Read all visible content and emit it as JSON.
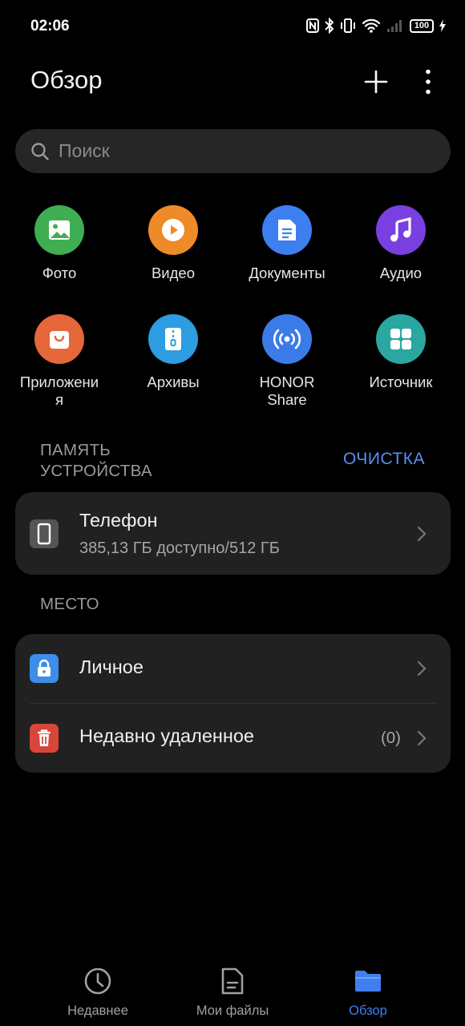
{
  "status_bar": {
    "time": "02:06",
    "battery": "100"
  },
  "header": {
    "title": "Обзор",
    "add_icon": "plus-icon",
    "menu_icon": "more-vertical-icon"
  },
  "search": {
    "placeholder": "Поиск"
  },
  "categories": [
    {
      "label": "Фото",
      "icon": "photo-icon",
      "color": "#3fae52"
    },
    {
      "label": "Видео",
      "icon": "video-play-icon",
      "color": "#ee8a27"
    },
    {
      "label": "Документы",
      "icon": "document-icon",
      "color": "#3d7ff0"
    },
    {
      "label": "Аудио",
      "icon": "music-note-icon",
      "color": "#7a3fe0"
    },
    {
      "label": "Приложени\nя",
      "icon": "shopping-bag-icon",
      "color": "#e5673a"
    },
    {
      "label": "Архивы",
      "icon": "zip-archive-icon",
      "color": "#2d9ce0"
    },
    {
      "label": "HONOR\nShare",
      "icon": "honor-share-icon",
      "color": "#3b7be8"
    },
    {
      "label": "Источник",
      "icon": "grid-source-icon",
      "color": "#2aa7a0"
    }
  ],
  "storage": {
    "section_label": "ПАМЯТЬ\nУСТРОЙСТВА",
    "clean_label": "ОЧИСТКА",
    "phone": {
      "title": "Телефон",
      "subtitle": "385,13 ГБ доступно/512 ГБ"
    }
  },
  "places": {
    "section_label": "МЕСТО",
    "items": [
      {
        "title": "Личное",
        "icon": "lock-icon",
        "color": "#3c8ee8"
      },
      {
        "title": "Недавно удаленное",
        "icon": "trash-icon",
        "color": "#d8453a",
        "count": "(0)"
      }
    ]
  },
  "bottom_nav": {
    "items": [
      {
        "label": "Недавнее",
        "icon": "clock-icon",
        "active": false
      },
      {
        "label": "Мои файлы",
        "icon": "file-icon",
        "active": false
      },
      {
        "label": "Обзор",
        "icon": "folder-icon",
        "active": true
      }
    ],
    "active_color": "#3f7ff0"
  },
  "accent_color": "#5b8cf5"
}
